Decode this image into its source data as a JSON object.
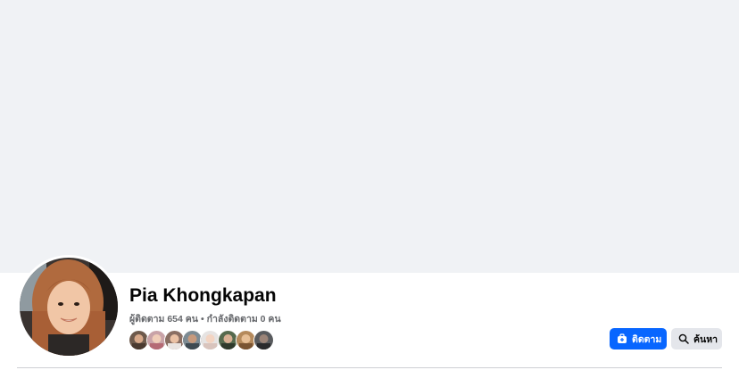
{
  "cover": {
    "color": "#f0f2f5"
  },
  "profile": {
    "name": "Pia Khongkapan",
    "followers_label": "ผู้ติดตาม 654 คน",
    "separator": "•",
    "following_label": "กำลังติดตาม 0 คน"
  },
  "follower_avatars": [
    "follower-1",
    "follower-2",
    "follower-3",
    "follower-4",
    "follower-5",
    "follower-6",
    "follower-7",
    "follower-8"
  ],
  "actions": {
    "follow_label": "ติดตาม",
    "follow_icon": "follow-icon",
    "search_label": "ค้นหา",
    "search_icon": "search-icon"
  },
  "colors": {
    "primary": "#0866ff",
    "secondary_button": "#e4e6eb",
    "text_primary": "#050505",
    "text_secondary": "#65676b"
  }
}
